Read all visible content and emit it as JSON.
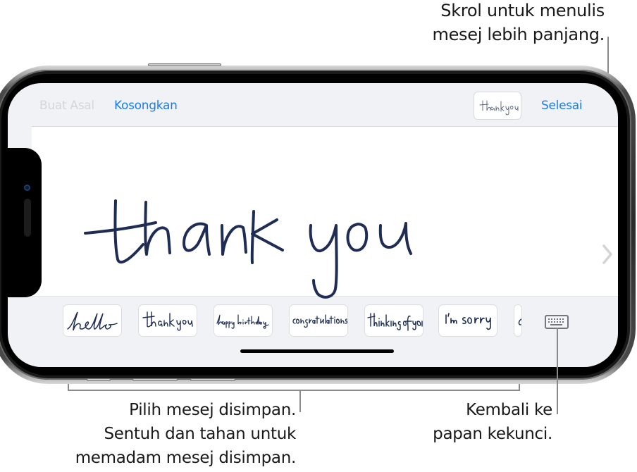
{
  "callouts": {
    "scroll": [
      "Skrol untuk menulis",
      "mesej lebih panjang."
    ],
    "saved": [
      "Pilih mesej disimpan.",
      "Sentuh dan tahan untuk",
      "memadam mesej disimpan."
    ],
    "keyboard": [
      "Kembali ke",
      "papan kekunci."
    ]
  },
  "toolbar": {
    "default_label": "Buat Asal",
    "clear_label": "Kosongkan",
    "done_label": "Selesai",
    "preview_text": "thank you"
  },
  "canvas": {
    "handwritten_text": "thank you",
    "ink_color": "#1f2d55",
    "scroll_icon": "chevron-right-icon"
  },
  "saved_messages": [
    {
      "label": "hello"
    },
    {
      "label": "thank you"
    },
    {
      "label": "happy birthday"
    },
    {
      "label": "congratulations"
    },
    {
      "label": "thinking of you"
    },
    {
      "label": "I'm sorry"
    },
    {
      "label": "(partially visible)"
    }
  ],
  "keyboard_button": {
    "icon": "keyboard-icon"
  },
  "colors": {
    "accent": "#1b7cf2",
    "disabled": "#d5d6da",
    "screen_bg": "#f1f2f6"
  }
}
